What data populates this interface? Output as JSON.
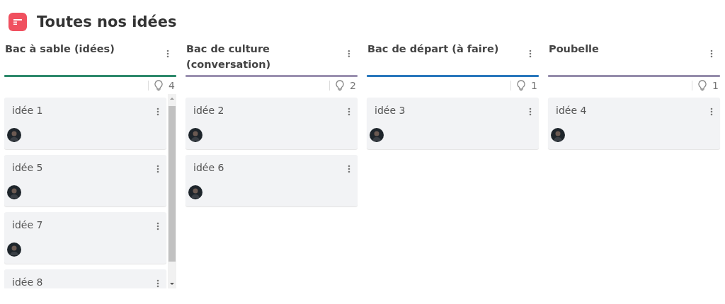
{
  "title": "Toutes nos idées",
  "columns": [
    {
      "name": "Bac à sable (idées)",
      "color": "#2e8a6c",
      "count": "4",
      "scrollable": true,
      "cards": [
        {
          "title": "idée 1"
        },
        {
          "title": "idée 5"
        },
        {
          "title": "idée 7"
        },
        {
          "title": "idée 8"
        }
      ]
    },
    {
      "name": "Bac de culture (conversation)",
      "color": "#9a90b0",
      "count": "2",
      "scrollable": false,
      "cards": [
        {
          "title": "idée 2"
        },
        {
          "title": "idée 6"
        }
      ]
    },
    {
      "name": "Bac de départ (à faire)",
      "color": "#2a78bd",
      "count": "1",
      "scrollable": false,
      "cards": [
        {
          "title": "idée 3"
        }
      ]
    },
    {
      "name": "Poubelle",
      "color": "#958cab",
      "count": "1",
      "scrollable": false,
      "cards": [
        {
          "title": "idée 4"
        }
      ]
    }
  ]
}
